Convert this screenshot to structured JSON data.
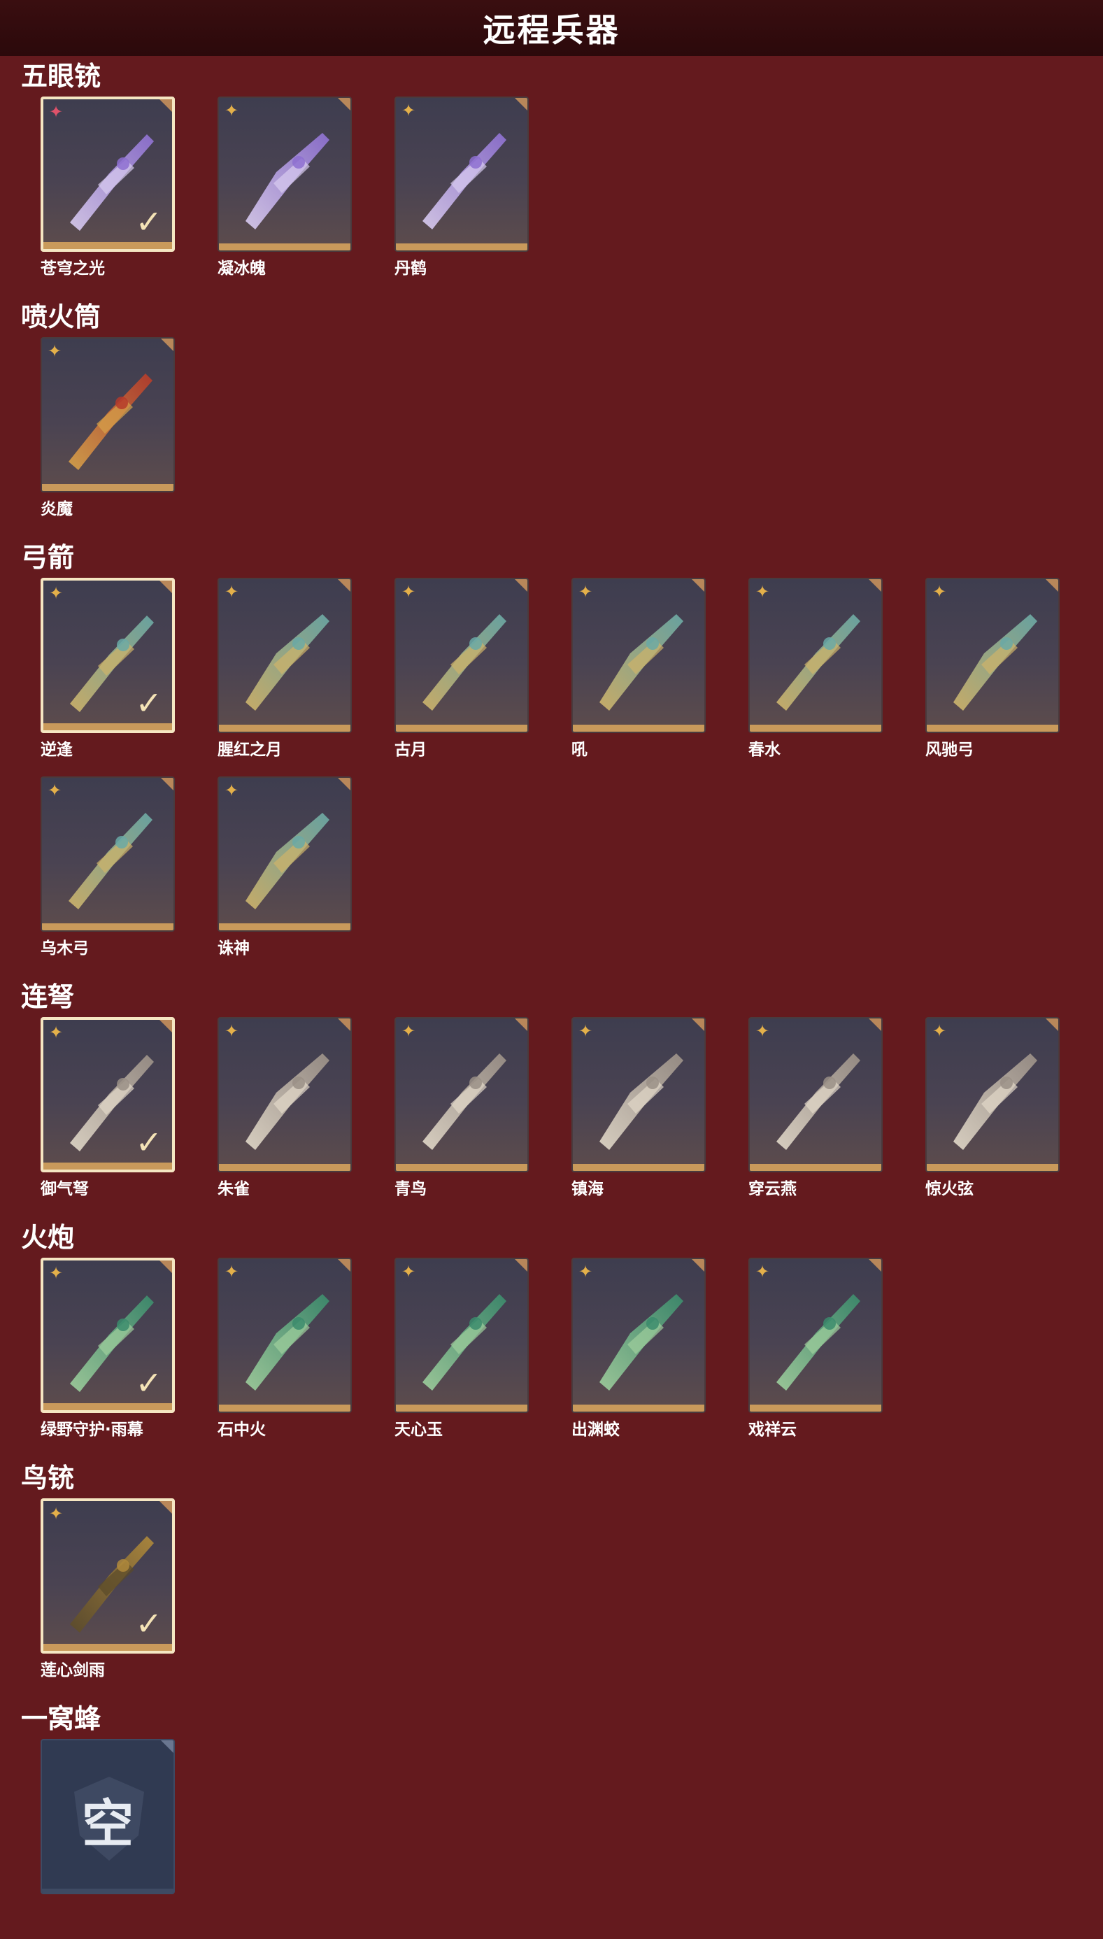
{
  "page": {
    "title": "远程兵器"
  },
  "sections": [
    {
      "title": "五眼铳",
      "items": [
        {
          "name": "苍穹之光",
          "rarity": "red",
          "equipped": true
        },
        {
          "name": "凝冰魄",
          "rarity": "gold",
          "equipped": false
        },
        {
          "name": "丹鹤",
          "rarity": "gold",
          "equipped": false
        }
      ]
    },
    {
      "title": "喷火筒",
      "items": [
        {
          "name": "炎魔",
          "rarity": "gold",
          "equipped": false
        }
      ]
    },
    {
      "title": "弓箭",
      "items": [
        {
          "name": "逆逢",
          "rarity": "gold",
          "equipped": true
        },
        {
          "name": "腥红之月",
          "rarity": "gold",
          "equipped": false
        },
        {
          "name": "古月",
          "rarity": "gold",
          "equipped": false
        },
        {
          "name": "吼",
          "rarity": "gold",
          "equipped": false
        },
        {
          "name": "春水",
          "rarity": "gold",
          "equipped": false
        },
        {
          "name": "风驰弓",
          "rarity": "gold",
          "equipped": false
        },
        {
          "name": "乌木弓",
          "rarity": "gold",
          "equipped": false
        },
        {
          "name": "诛神",
          "rarity": "gold",
          "equipped": false
        }
      ]
    },
    {
      "title": "连弩",
      "items": [
        {
          "name": "御气弩",
          "rarity": "gold",
          "equipped": true
        },
        {
          "name": "朱雀",
          "rarity": "gold",
          "equipped": false
        },
        {
          "name": "青鸟",
          "rarity": "gold",
          "equipped": false
        },
        {
          "name": "镇海",
          "rarity": "gold",
          "equipped": false
        },
        {
          "name": "穿云燕",
          "rarity": "gold",
          "equipped": false
        },
        {
          "name": "惊火弦",
          "rarity": "gold",
          "equipped": false
        }
      ]
    },
    {
      "title": "火炮",
      "items": [
        {
          "name": "绿野守护·雨幕",
          "rarity": "gold",
          "equipped": true
        },
        {
          "name": "石中火",
          "rarity": "gold",
          "equipped": false
        },
        {
          "name": "天心玉",
          "rarity": "gold",
          "equipped": false
        },
        {
          "name": "出渊蛟",
          "rarity": "gold",
          "equipped": false
        },
        {
          "name": "戏祥云",
          "rarity": "gold",
          "equipped": false
        }
      ]
    },
    {
      "title": "鸟铳",
      "items": [
        {
          "name": "莲心剑雨",
          "rarity": "gold",
          "equipped": true
        }
      ]
    },
    {
      "title": "一窝蜂",
      "items": [
        {
          "name": "",
          "empty": true,
          "empty_text": "空"
        }
      ]
    }
  ],
  "colors": {
    "background": "#641a1e",
    "header": "#2b090b",
    "rarity_gold": "#e4b04a",
    "rarity_red": "#e0526a",
    "equipped_border": "#f5e6c2",
    "card_bar": "#c99a5b"
  },
  "icons": {
    "rarity": "four-point-star-icon",
    "equipped": "checkmark-icon",
    "corner": "corner-flag-icon"
  }
}
